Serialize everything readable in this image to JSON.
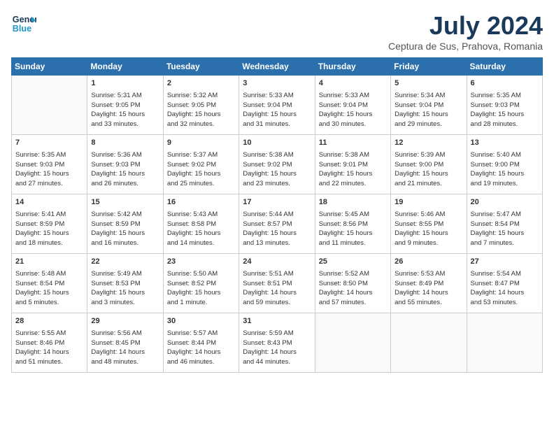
{
  "header": {
    "logo_line1": "General",
    "logo_line2": "Blue",
    "month": "July 2024",
    "location": "Ceptura de Sus, Prahova, Romania"
  },
  "days_of_week": [
    "Sunday",
    "Monday",
    "Tuesday",
    "Wednesday",
    "Thursday",
    "Friday",
    "Saturday"
  ],
  "weeks": [
    [
      {
        "day": "",
        "content": ""
      },
      {
        "day": "1",
        "content": "Sunrise: 5:31 AM\nSunset: 9:05 PM\nDaylight: 15 hours\nand 33 minutes."
      },
      {
        "day": "2",
        "content": "Sunrise: 5:32 AM\nSunset: 9:05 PM\nDaylight: 15 hours\nand 32 minutes."
      },
      {
        "day": "3",
        "content": "Sunrise: 5:33 AM\nSunset: 9:04 PM\nDaylight: 15 hours\nand 31 minutes."
      },
      {
        "day": "4",
        "content": "Sunrise: 5:33 AM\nSunset: 9:04 PM\nDaylight: 15 hours\nand 30 minutes."
      },
      {
        "day": "5",
        "content": "Sunrise: 5:34 AM\nSunset: 9:04 PM\nDaylight: 15 hours\nand 29 minutes."
      },
      {
        "day": "6",
        "content": "Sunrise: 5:35 AM\nSunset: 9:03 PM\nDaylight: 15 hours\nand 28 minutes."
      }
    ],
    [
      {
        "day": "7",
        "content": "Sunrise: 5:35 AM\nSunset: 9:03 PM\nDaylight: 15 hours\nand 27 minutes."
      },
      {
        "day": "8",
        "content": "Sunrise: 5:36 AM\nSunset: 9:03 PM\nDaylight: 15 hours\nand 26 minutes."
      },
      {
        "day": "9",
        "content": "Sunrise: 5:37 AM\nSunset: 9:02 PM\nDaylight: 15 hours\nand 25 minutes."
      },
      {
        "day": "10",
        "content": "Sunrise: 5:38 AM\nSunset: 9:02 PM\nDaylight: 15 hours\nand 23 minutes."
      },
      {
        "day": "11",
        "content": "Sunrise: 5:38 AM\nSunset: 9:01 PM\nDaylight: 15 hours\nand 22 minutes."
      },
      {
        "day": "12",
        "content": "Sunrise: 5:39 AM\nSunset: 9:00 PM\nDaylight: 15 hours\nand 21 minutes."
      },
      {
        "day": "13",
        "content": "Sunrise: 5:40 AM\nSunset: 9:00 PM\nDaylight: 15 hours\nand 19 minutes."
      }
    ],
    [
      {
        "day": "14",
        "content": "Sunrise: 5:41 AM\nSunset: 8:59 PM\nDaylight: 15 hours\nand 18 minutes."
      },
      {
        "day": "15",
        "content": "Sunrise: 5:42 AM\nSunset: 8:59 PM\nDaylight: 15 hours\nand 16 minutes."
      },
      {
        "day": "16",
        "content": "Sunrise: 5:43 AM\nSunset: 8:58 PM\nDaylight: 15 hours\nand 14 minutes."
      },
      {
        "day": "17",
        "content": "Sunrise: 5:44 AM\nSunset: 8:57 PM\nDaylight: 15 hours\nand 13 minutes."
      },
      {
        "day": "18",
        "content": "Sunrise: 5:45 AM\nSunset: 8:56 PM\nDaylight: 15 hours\nand 11 minutes."
      },
      {
        "day": "19",
        "content": "Sunrise: 5:46 AM\nSunset: 8:55 PM\nDaylight: 15 hours\nand 9 minutes."
      },
      {
        "day": "20",
        "content": "Sunrise: 5:47 AM\nSunset: 8:54 PM\nDaylight: 15 hours\nand 7 minutes."
      }
    ],
    [
      {
        "day": "21",
        "content": "Sunrise: 5:48 AM\nSunset: 8:54 PM\nDaylight: 15 hours\nand 5 minutes."
      },
      {
        "day": "22",
        "content": "Sunrise: 5:49 AM\nSunset: 8:53 PM\nDaylight: 15 hours\nand 3 minutes."
      },
      {
        "day": "23",
        "content": "Sunrise: 5:50 AM\nSunset: 8:52 PM\nDaylight: 15 hours\nand 1 minute."
      },
      {
        "day": "24",
        "content": "Sunrise: 5:51 AM\nSunset: 8:51 PM\nDaylight: 14 hours\nand 59 minutes."
      },
      {
        "day": "25",
        "content": "Sunrise: 5:52 AM\nSunset: 8:50 PM\nDaylight: 14 hours\nand 57 minutes."
      },
      {
        "day": "26",
        "content": "Sunrise: 5:53 AM\nSunset: 8:49 PM\nDaylight: 14 hours\nand 55 minutes."
      },
      {
        "day": "27",
        "content": "Sunrise: 5:54 AM\nSunset: 8:47 PM\nDaylight: 14 hours\nand 53 minutes."
      }
    ],
    [
      {
        "day": "28",
        "content": "Sunrise: 5:55 AM\nSunset: 8:46 PM\nDaylight: 14 hours\nand 51 minutes."
      },
      {
        "day": "29",
        "content": "Sunrise: 5:56 AM\nSunset: 8:45 PM\nDaylight: 14 hours\nand 48 minutes."
      },
      {
        "day": "30",
        "content": "Sunrise: 5:57 AM\nSunset: 8:44 PM\nDaylight: 14 hours\nand 46 minutes."
      },
      {
        "day": "31",
        "content": "Sunrise: 5:59 AM\nSunset: 8:43 PM\nDaylight: 14 hours\nand 44 minutes."
      },
      {
        "day": "",
        "content": ""
      },
      {
        "day": "",
        "content": ""
      },
      {
        "day": "",
        "content": ""
      }
    ]
  ]
}
